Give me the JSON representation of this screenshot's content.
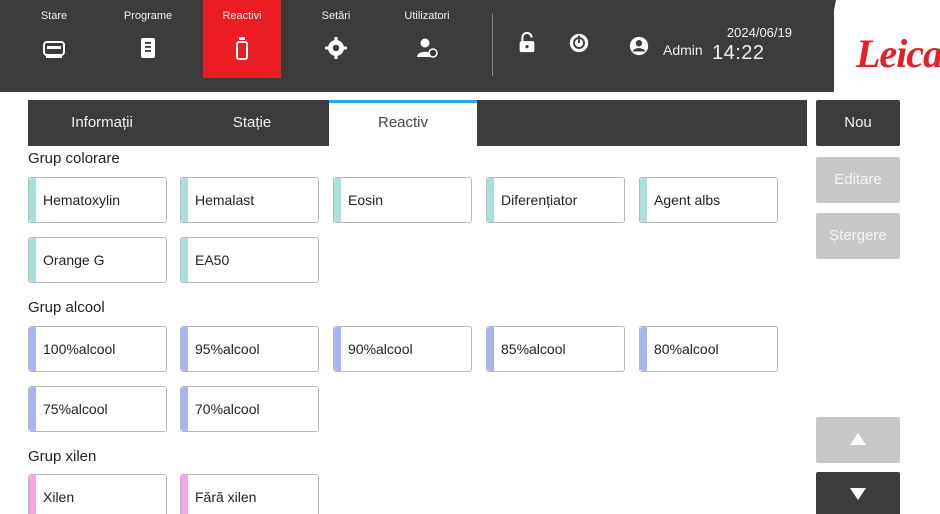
{
  "nav": {
    "items": [
      {
        "label": "Stare",
        "icon": "status-icon"
      },
      {
        "label": "Programe",
        "icon": "programs-icon"
      },
      {
        "label": "Reactivi",
        "icon": "reagent-icon"
      },
      {
        "label": "Setări",
        "icon": "settings-icon"
      },
      {
        "label": "Utilizatori",
        "icon": "users-icon"
      }
    ],
    "active": "Reactivi",
    "active_color": "#ec1c24"
  },
  "status": {
    "user": "Admin",
    "date": "2024/06/19",
    "time": "14:22",
    "icons": [
      "unlock-icon",
      "power-icon",
      "user-icon"
    ]
  },
  "brand": {
    "logo": "Leica",
    "color": "#e2202a"
  },
  "tabs": [
    "Informații",
    "Stație",
    "Reactiv"
  ],
  "active_tab": "Reactiv",
  "accent": "#29abe2",
  "groups": [
    {
      "title": "Grup colorare",
      "color": "#a8e0dc",
      "items": [
        "Hematoxylin",
        "Hemalast",
        "Eosin",
        "Diferențiator",
        "Agent albs",
        "Orange G",
        "EA50"
      ]
    },
    {
      "title": "Grup alcool",
      "color": "#a9b4f0",
      "items": [
        "100%alcool",
        "95%alcool",
        "90%alcool",
        "85%alcool",
        "80%alcool",
        "75%alcool",
        "70%alcool"
      ]
    },
    {
      "title": "Grup xilen",
      "color": "#f2a6e6",
      "items": [
        "Xilen",
        "Fără xilen"
      ]
    }
  ],
  "actions": {
    "new": "Nou",
    "edit": "Editare",
    "delete": "Ștergere"
  },
  "scroll": [
    "scroll-up-icon",
    "scroll-down-icon"
  ]
}
